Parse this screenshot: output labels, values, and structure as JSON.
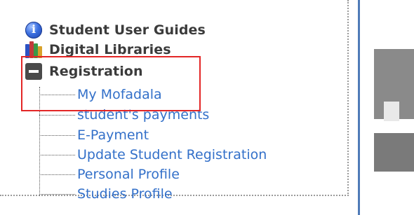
{
  "menu": {
    "items": [
      {
        "label": "Student User Guides",
        "icon": "info-icon"
      },
      {
        "label": "Digital Libraries",
        "icon": "books-icon"
      },
      {
        "label": "Registration",
        "icon": "collapse-minus-icon",
        "expanded": true
      }
    ],
    "registration_children": [
      "My Mofadala",
      "student's payments",
      "E-Payment",
      "Update Student Registration",
      "Personal Profile",
      "Studies Profile"
    ]
  },
  "colors": {
    "link": "#3370c9",
    "highlight": "#e32626",
    "separator": "#4f7bb8"
  }
}
